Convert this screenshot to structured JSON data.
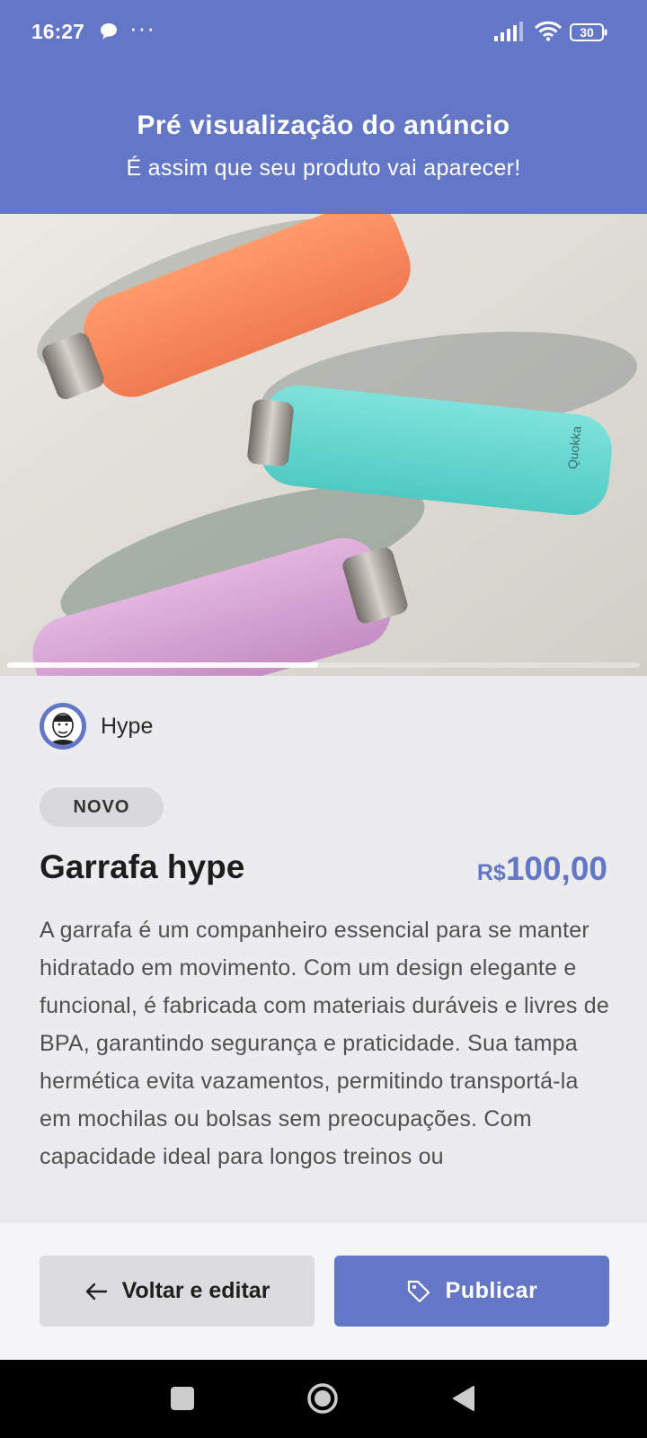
{
  "status_bar": {
    "time": "16:27",
    "dots": "···",
    "battery": "30"
  },
  "header": {
    "title": "Pré visualização do anúncio",
    "subtitle": "É assim que seu produto vai aparecer!"
  },
  "product_image": {
    "description": "Quokka bottles",
    "brand_print": "Quokka",
    "carousel": {
      "current": 1,
      "total": 2
    }
  },
  "seller": {
    "name": "Hype"
  },
  "product": {
    "condition": "NOVO",
    "title": "Garrafa hype",
    "currency": "R$",
    "price": "100,00",
    "description": "A garrafa é um companheiro essencial para se manter hidratado em movimento. Com um design elegante e funcional, é fabricada com materiais duráveis e livres de BPA, garantindo segurança e praticidade. Sua tampa hermética evita vazamentos, permitindo transportá-la em mochilas ou bolsas sem preocupações. Com capacidade ideal para longos treinos ou"
  },
  "actions": {
    "back_label": "Voltar e editar",
    "publish_label": "Publicar"
  },
  "colors": {
    "primary": "#6477c6",
    "background": "#ececef",
    "badge": "#d9d9dc",
    "secondary_button": "#dcdcde"
  },
  "icons": {
    "back": "arrow-left-icon",
    "publish": "tag-icon",
    "nav": [
      "recents-square-icon",
      "home-circle-icon",
      "back-triangle-icon"
    ]
  }
}
